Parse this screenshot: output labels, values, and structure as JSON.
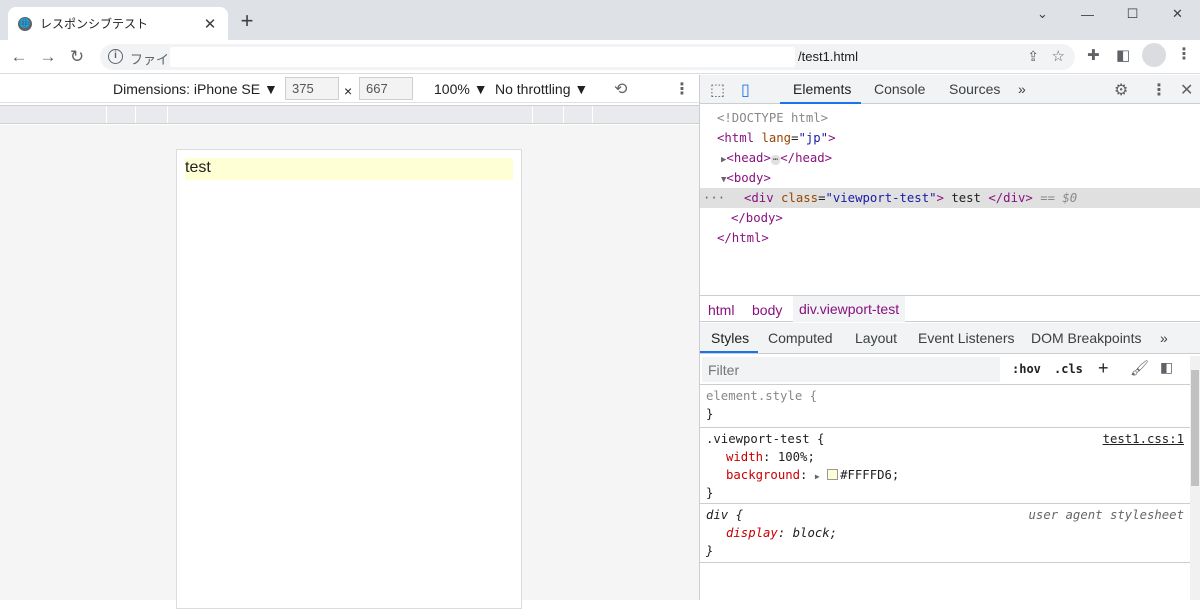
{
  "tab": {
    "title": "レスポンシブテスト",
    "close": "✕",
    "new_tab": "+"
  },
  "window_controls": {
    "minimize": "—",
    "maximize": "☐",
    "close": "✕",
    "tabsearch": "⌄"
  },
  "address": {
    "label": "ファイル",
    "url": "/test1.html"
  },
  "device_toolbar": {
    "dimensions": "Dimensions: iPhone SE ▼",
    "width": "375",
    "x": "×",
    "height": "667",
    "zoom": "100% ▼",
    "throttling": "No throttling ▼"
  },
  "page": {
    "text": "test"
  },
  "devtools": {
    "tabs": [
      "Elements",
      "Console",
      "Sources"
    ],
    "more_tabs": "»",
    "dom": {
      "doctype": "<!DOCTYPE html>",
      "html_open_tag": "<html",
      "html_attr": "lang",
      "html_attr_val": "\"jp\"",
      "html_open_close": ">",
      "head_open": "<head>",
      "ellipsis": "⋯",
      "head_close": "</head>",
      "body_open": "<body>",
      "div_open": "<div",
      "div_attr": "class",
      "div_attr_val": "\"viewport-test\"",
      "div_gt": ">",
      "div_text": " test ",
      "div_close": "</div>",
      "sel_marker": "== $0",
      "dots": "···",
      "body_close": "</body>",
      "html_close": "</html>"
    },
    "breadcrumbs": [
      "html",
      "body",
      "div.viewport-test"
    ],
    "styles_tabs": [
      "Styles",
      "Computed",
      "Layout",
      "Event Listeners",
      "DOM Breakpoints"
    ],
    "styles_more": "»",
    "filter_placeholder": "Filter",
    "hov": ":hov",
    "cls": ".cls",
    "plus": "+",
    "rules": {
      "element_style": "element.style {",
      "brace_close": "}",
      "vt_selector": ".viewport-test {",
      "vt_source": "test1.css:1",
      "width_prop": "width",
      "width_val": "100%;",
      "bg_prop": "background",
      "bg_val": "#FFFFD6;",
      "div_selector": "div {",
      "div_source": "user agent stylesheet",
      "display_prop": "display",
      "display_val": "block;"
    }
  },
  "colors": {
    "highlight": "#FFFFD6",
    "tag": "#881280",
    "attr": "#994500",
    "value": "#1A1AA6"
  }
}
